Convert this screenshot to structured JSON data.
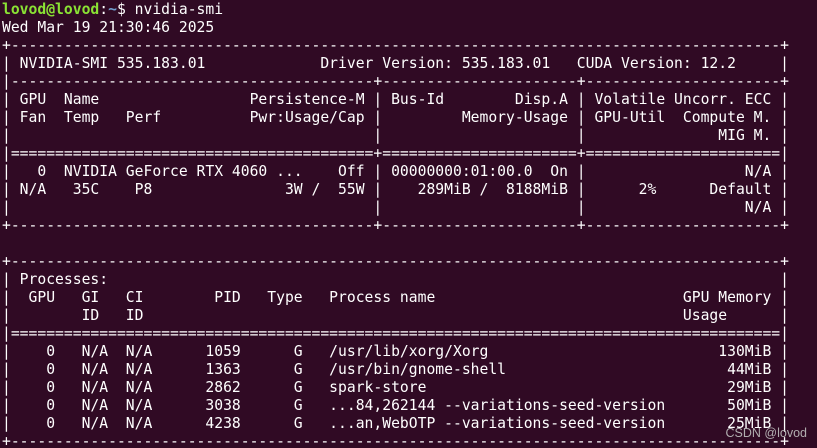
{
  "prompt": {
    "user_host": "lovod@lovod",
    "separator": ":",
    "path": "~",
    "symbol": "$ ",
    "command": "nvidia-smi"
  },
  "output": {
    "lines": [
      "Wed Mar 19 21:30:46 2025",
      "+---------------------------------------------------------------------------------------+",
      "| NVIDIA-SMI 535.183.01             Driver Version: 535.183.01   CUDA Version: 12.2     |",
      "|-----------------------------------------+----------------------+----------------------+",
      "| GPU  Name                 Persistence-M | Bus-Id        Disp.A | Volatile Uncorr. ECC |",
      "| Fan  Temp   Perf          Pwr:Usage/Cap |         Memory-Usage | GPU-Util  Compute M. |",
      "|                                         |                      |               MIG M. |",
      "|=========================================+======================+======================|",
      "|   0  NVIDIA GeForce RTX 4060 ...    Off | 00000000:01:00.0  On |                  N/A |",
      "| N/A   35C    P8               3W /  55W |    289MiB /  8188MiB |      2%      Default |",
      "|                                         |                      |                  N/A |",
      "+-----------------------------------------+----------------------+----------------------+",
      "",
      "+---------------------------------------------------------------------------------------+",
      "| Processes:                                                                            |",
      "|  GPU   GI   CI        PID   Type   Process name                            GPU Memory |",
      "|        ID   ID                                                             Usage      |",
      "|=======================================================================================|",
      "|    0   N/A  N/A      1059      G   /usr/lib/xorg/Xorg                          130MiB |",
      "|    0   N/A  N/A      1363      G   /usr/bin/gnome-shell                         44MiB |",
      "|    0   N/A  N/A      2862      G   spark-store                                  29MiB |",
      "|    0   N/A  N/A      3038      G   ...84,262144 --variations-seed-version       50MiB |",
      "|    0   N/A  N/A      4238      G   ...an,WebOTP --variations-seed-version       25MiB |",
      "+---------------------------------------------------------------------------------------+"
    ]
  },
  "watermark": "CSDN @lovod",
  "colors": {
    "background": "#300a24",
    "text": "#ffffff",
    "prompt_user": "#8ae234",
    "prompt_path": "#729fcf"
  }
}
